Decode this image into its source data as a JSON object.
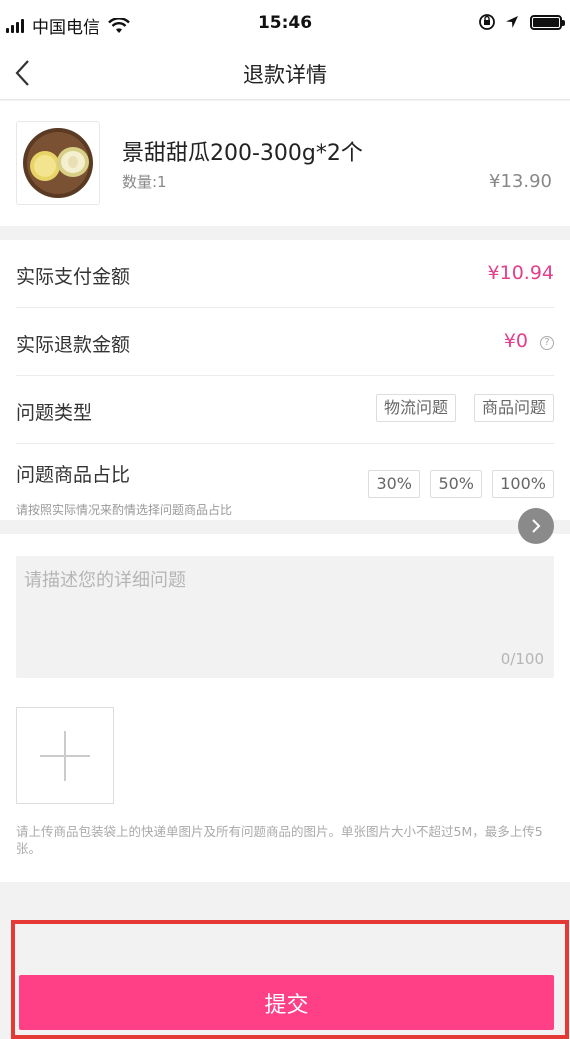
{
  "status_bar": {
    "carrier": "中国电信",
    "time": "15:46",
    "icons": [
      "signal-icon",
      "wifi-icon",
      "rotation-lock-icon",
      "location-icon",
      "battery-icon"
    ]
  },
  "nav": {
    "title": "退款详情",
    "back_icon": "chevron-left-icon"
  },
  "product": {
    "name": "景甜甜瓜200-300g*2个",
    "quantity": "数量:1",
    "price": "¥13.90"
  },
  "details": {
    "paid_label": "实际支付金额",
    "paid_value": "¥10.94",
    "refund_label": "实际退款金额",
    "refund_value": "¥0",
    "help_symbol": "?",
    "issue_type_label": "问题类型",
    "issue_types": [
      "物流问题",
      "商品问题"
    ],
    "ratio_label": "问题商品占比",
    "ratio_hint": "请按照实际情况来酌情选择问题商品占比",
    "ratios": [
      "30%",
      "50%",
      "100%"
    ]
  },
  "description": {
    "placeholder": "请描述您的详细问题",
    "counter": "0/100"
  },
  "upload": {
    "hint": "请上传商品包装袋上的快递单图片及所有问题商品的图片。单张图片大小不超过5M，最多上传5张。"
  },
  "submit": {
    "label": "提交"
  },
  "colors": {
    "accent": "#ff4087",
    "price_pink": "#e33f8a",
    "highlight": "#e53935"
  }
}
